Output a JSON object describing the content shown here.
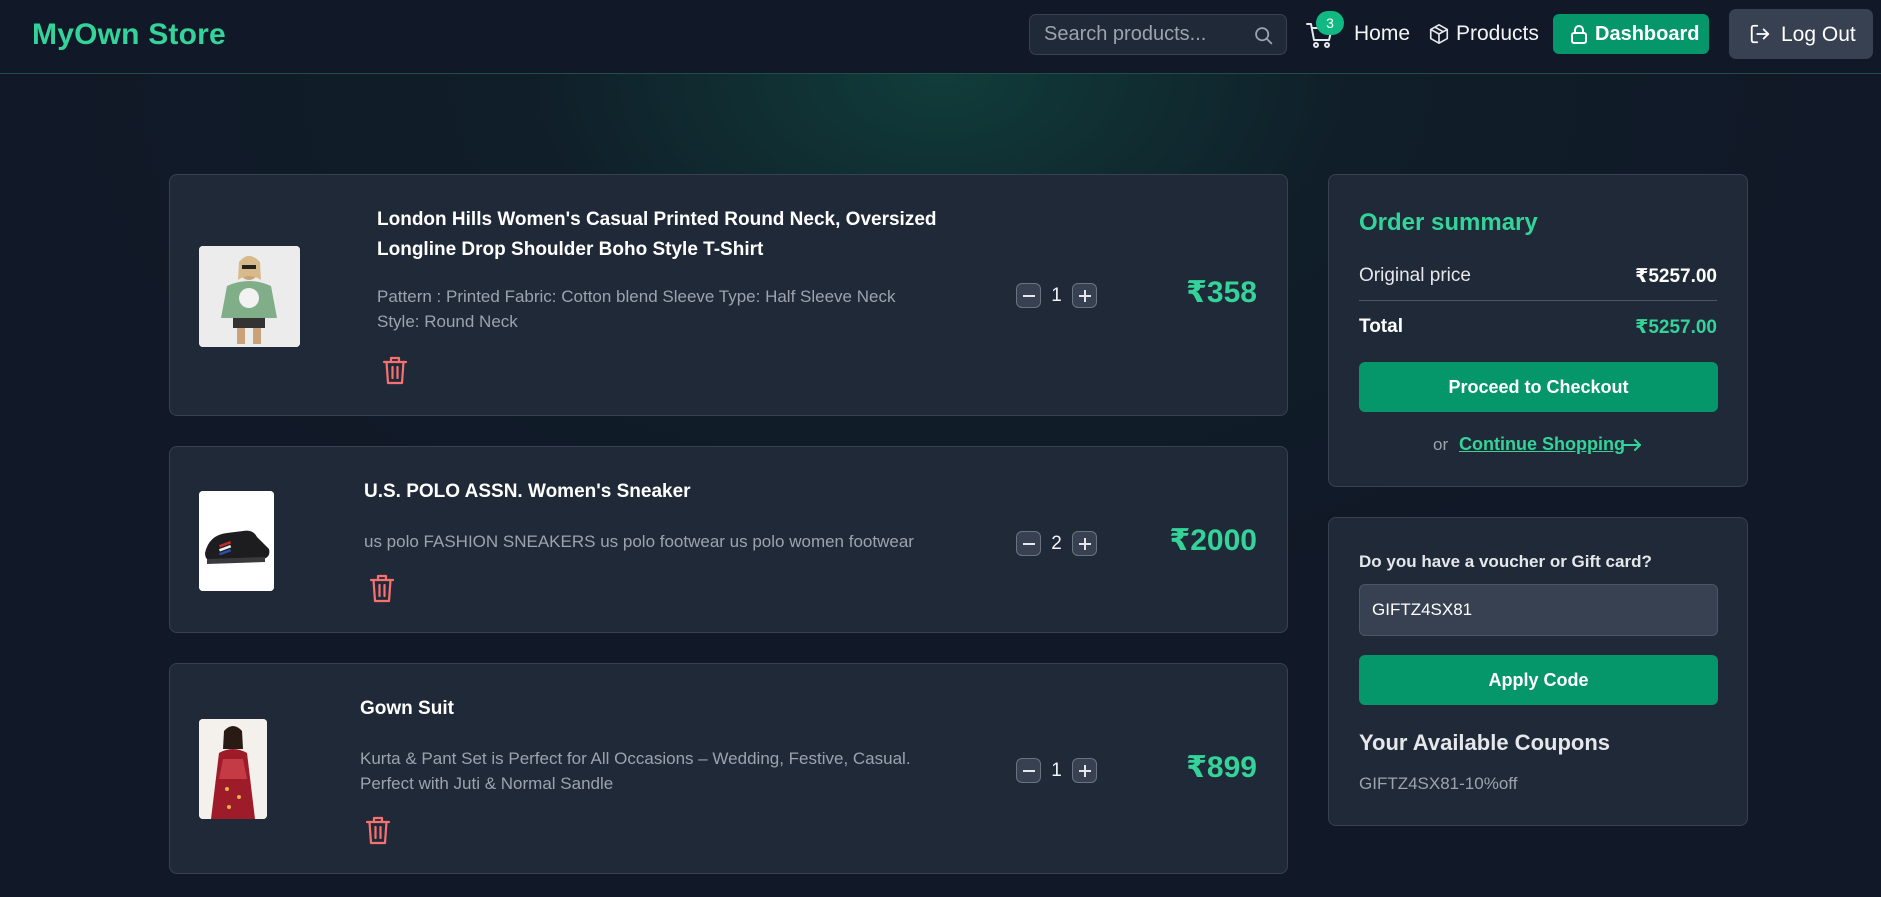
{
  "header": {
    "brand": "MyOwn Store",
    "search_placeholder": "Search products...",
    "cart_count": "3",
    "nav_home": "Home",
    "nav_products": "Products",
    "dashboard_label": "Dashboard",
    "logout_label": "Log Out"
  },
  "cart": {
    "items": [
      {
        "title": "London Hills Women's Casual Printed Round Neck, Oversized Longline Drop Shoulder Boho Style T-Shirt",
        "description": "Pattern : Printed Fabric: Cotton blend Sleeve Type: Half Sleeve Neck Style: Round Neck",
        "quantity": "1",
        "price": "₹358"
      },
      {
        "title": "U.S. POLO ASSN. Women's Sneaker",
        "description": "us polo FASHION SNEAKERS us polo footwear us polo women footwear",
        "quantity": "2",
        "price": "₹2000"
      },
      {
        "title": "Gown Suit",
        "description": "Kurta & Pant Set is Perfect for All Occasions – Wedding, Festive, Casual. Perfect with Juti & Normal Sandle",
        "quantity": "1",
        "price": "₹899"
      }
    ]
  },
  "summary": {
    "title": "Order summary",
    "original_price_label": "Original price",
    "original_price_value": "₹5257.00",
    "total_label": "Total",
    "total_value": "₹5257.00",
    "checkout_label": "Proceed to Checkout",
    "or_text": "or",
    "continue_label": "Continue Shopping"
  },
  "voucher": {
    "label": "Do you have a voucher or Gift card?",
    "input_value": "GIFTZ4SX81",
    "apply_label": "Apply Code",
    "coupons_title": "Your Available Coupons",
    "coupon_entry": "GIFTZ4SX81-10%off"
  },
  "colors": {
    "accent": "#34d399",
    "button": "#059669",
    "panel": "#1f2937",
    "background": "#111827",
    "trash": "#f87171"
  }
}
